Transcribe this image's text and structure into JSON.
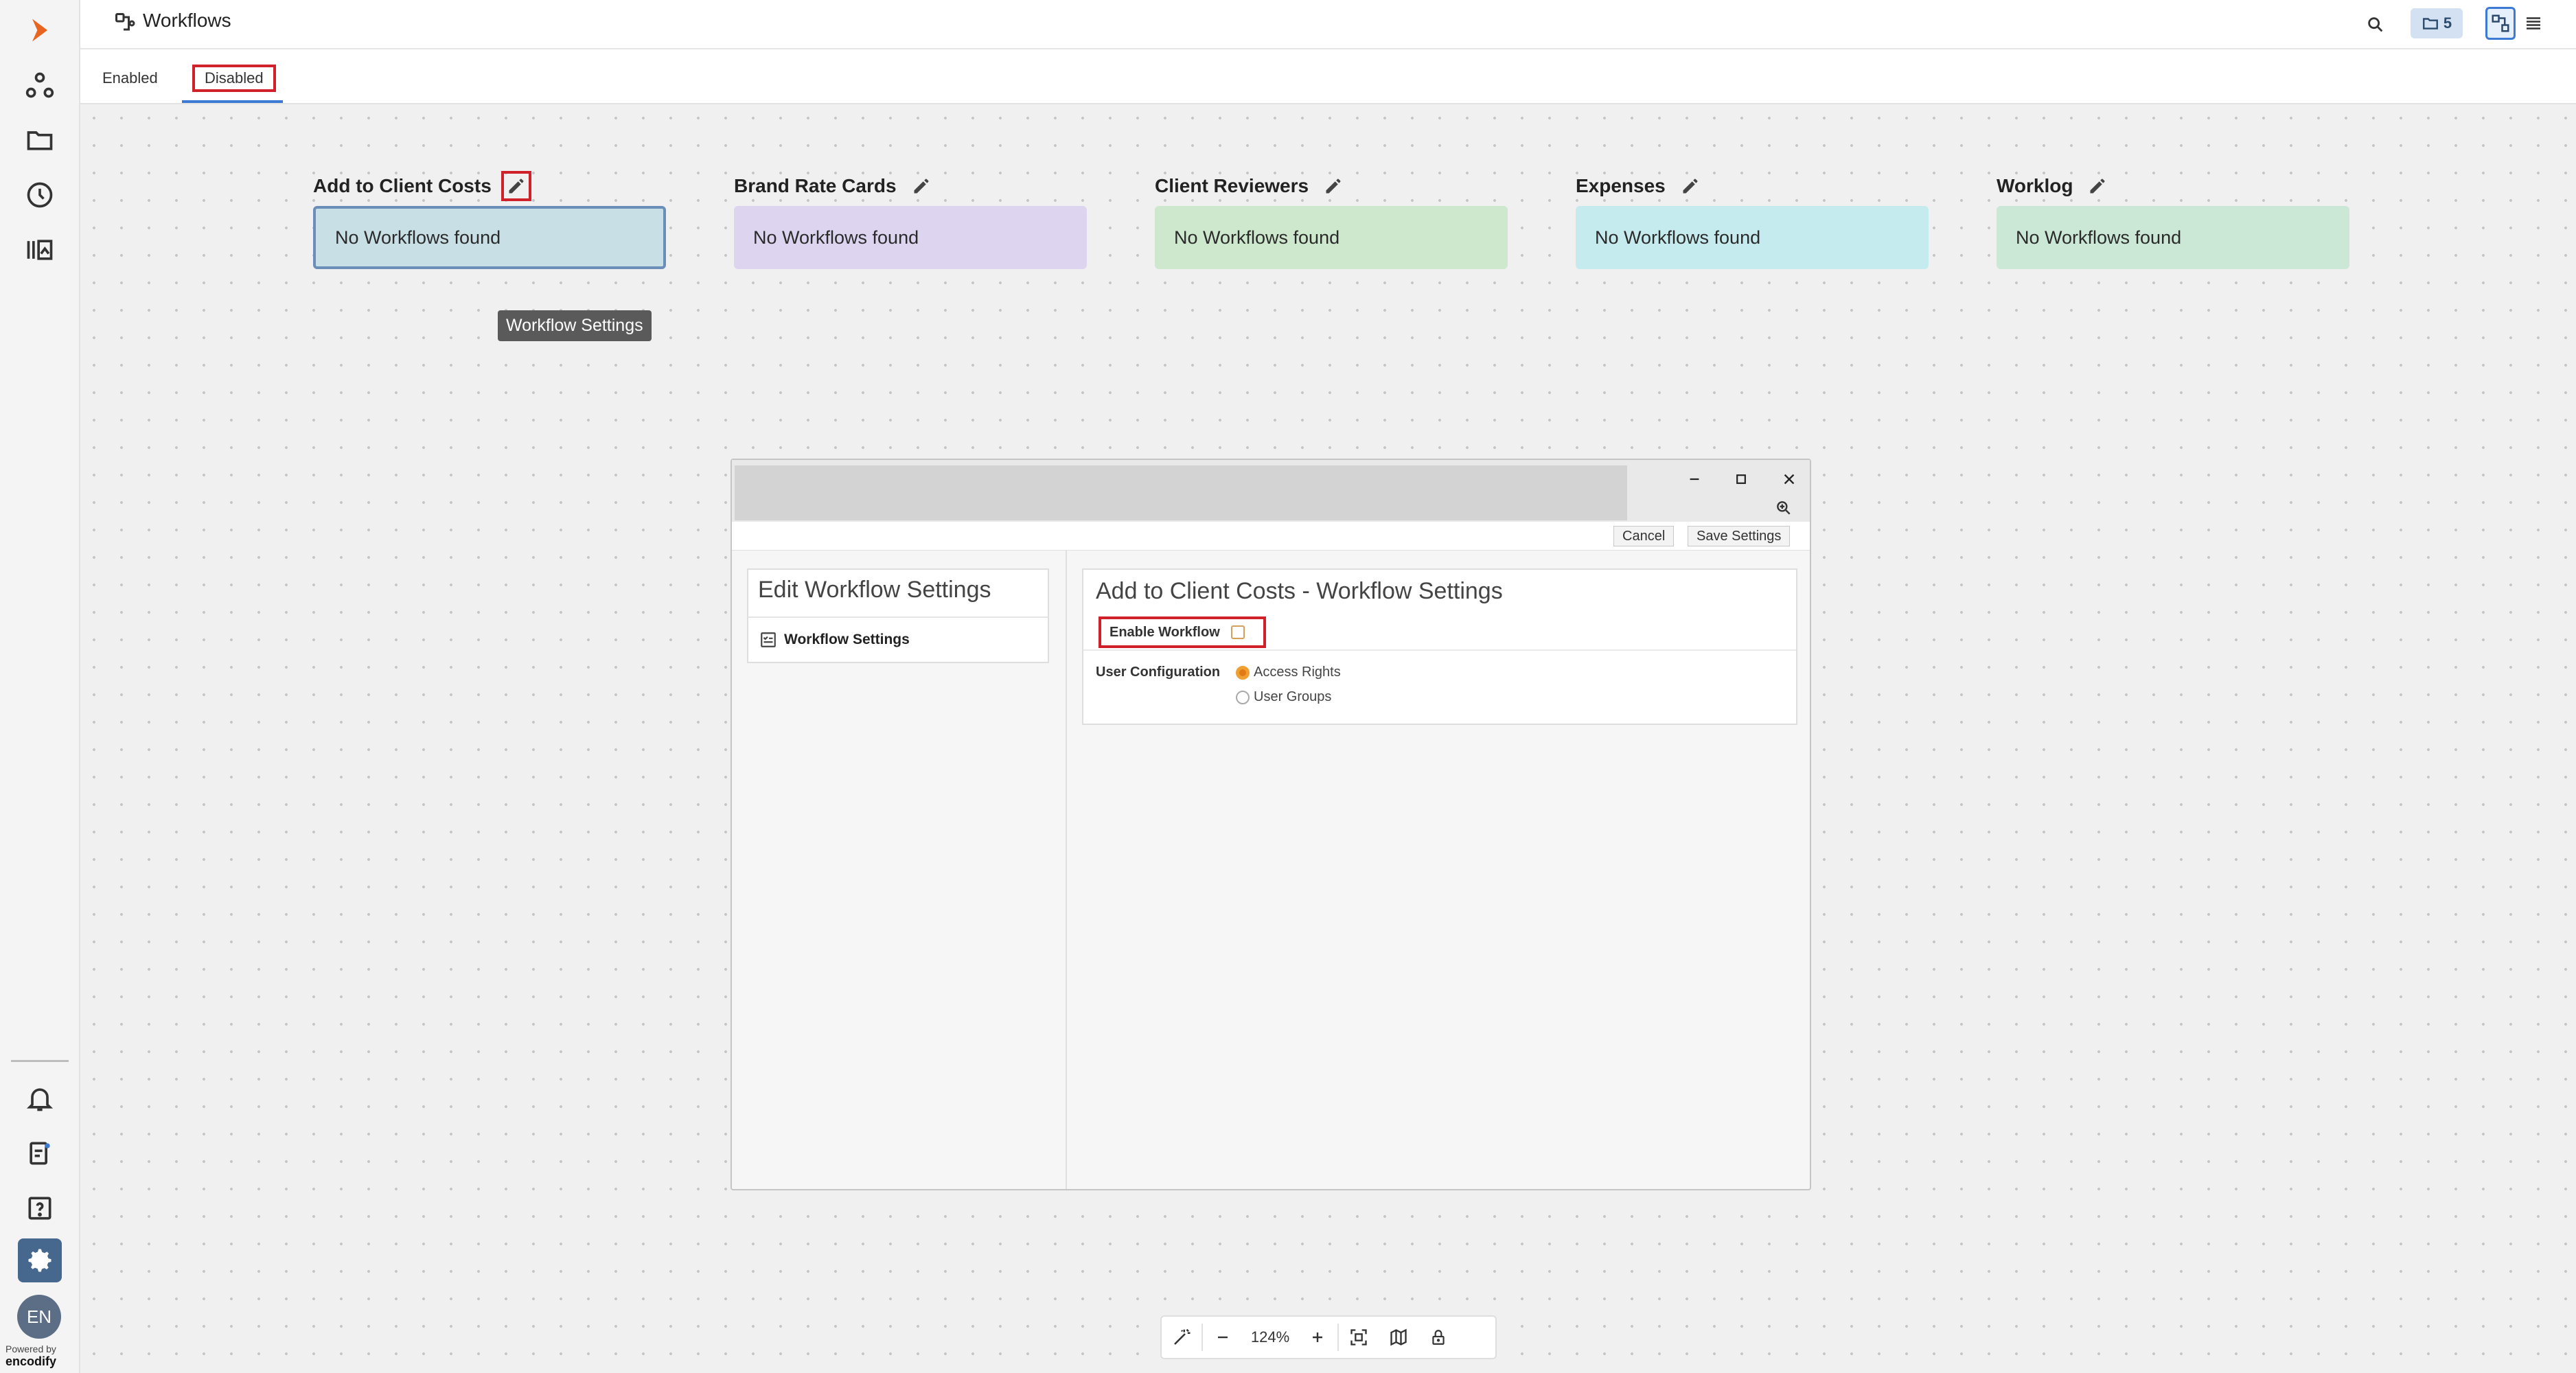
{
  "app": {
    "title": "Workflows",
    "folder_count": "5",
    "powered_by": "Powered by",
    "brand": "encodify",
    "language": "EN"
  },
  "colors": {
    "accent": "#3d7ad3",
    "highlight_box": "#d0202a",
    "settings_active": "#46688f",
    "radio_selected": "#e07a12"
  },
  "rail": {
    "items": [
      {
        "name": "logo-icon"
      },
      {
        "name": "network-icon"
      },
      {
        "name": "folder-icon"
      },
      {
        "name": "history-icon"
      },
      {
        "name": "library-icon"
      },
      {
        "name": "bell-icon"
      },
      {
        "name": "task-icon"
      },
      {
        "name": "help-icon"
      },
      {
        "name": "gear-icon",
        "active": true
      }
    ]
  },
  "tabs": [
    {
      "label": "Enabled",
      "active": false
    },
    {
      "label": "Disabled",
      "active": true
    }
  ],
  "columns": [
    {
      "title": "Add to Client Costs",
      "body": "No Workflows found",
      "color": "#c8dfe6"
    },
    {
      "title": "Brand Rate Cards",
      "body": "No Workflows found",
      "color": "#ddd4f0"
    },
    {
      "title": "Client Reviewers",
      "body": "No Workflows found",
      "color": "#cde8cd"
    },
    {
      "title": "Expenses",
      "body": "No Workflows found",
      "color": "#c6ebee"
    },
    {
      "title": "Worklog",
      "body": "No Workflows found",
      "color": "#cbe8d6"
    }
  ],
  "tooltip": "Workflow Settings",
  "dialog": {
    "cancel_label": "Cancel",
    "save_label": "Save Settings",
    "left_title": "Edit Workflow Settings",
    "left_item": "Workflow Settings",
    "right_title": "Add to Client Costs - Workflow Settings",
    "enable_label": "Enable Workflow",
    "enable_checked": false,
    "user_config_label": "User Configuration",
    "options": [
      {
        "label": "Access Rights",
        "selected": true
      },
      {
        "label": "User Groups",
        "selected": false
      }
    ]
  },
  "zoom": {
    "level": "124%"
  }
}
